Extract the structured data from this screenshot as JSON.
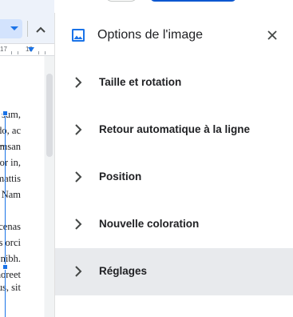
{
  "document": {
    "ruler": {
      "mark_left": "17",
      "mark_right": "18"
    },
    "text_lines": [
      "sum,",
      "do, ac",
      "msan",
      "olor in,",
      "mattis",
      ". Nam",
      "cenas",
      "us orci",
      "nibh.",
      "aoreet",
      "us, sit"
    ]
  },
  "panel": {
    "title": "Options de l'image",
    "icon": "image-icon",
    "close_icon": "close-icon",
    "sections": [
      {
        "label": "Taille et rotation",
        "icon": "chevron-right-icon",
        "active": false
      },
      {
        "label": "Retour automatique à la ligne",
        "icon": "chevron-right-icon",
        "active": false
      },
      {
        "label": "Position",
        "icon": "chevron-right-icon",
        "active": false
      },
      {
        "label": "Nouvelle coloration",
        "icon": "chevron-right-icon",
        "active": false
      },
      {
        "label": "Réglages",
        "icon": "chevron-right-icon",
        "active": true
      }
    ]
  },
  "colors": {
    "accent": "#1a73e8",
    "active_section_bg": "#e8eaed",
    "title_text": "#202124"
  }
}
